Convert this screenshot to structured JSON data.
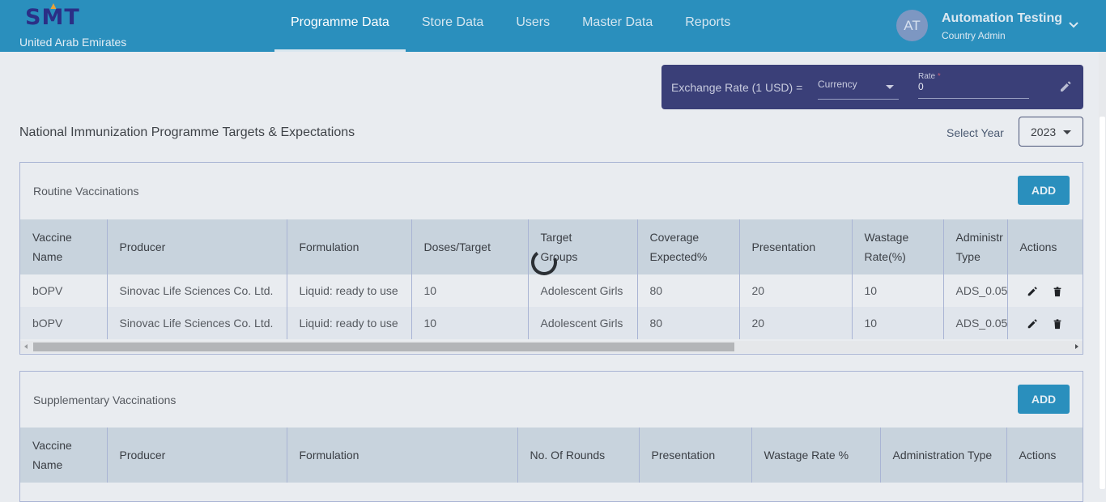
{
  "header": {
    "logo_text": "SMT",
    "country": "United Arab Emirates",
    "nav": [
      {
        "label": "Programme Data",
        "active": true
      },
      {
        "label": "Store Data",
        "active": false
      },
      {
        "label": "Users",
        "active": false
      },
      {
        "label": "Master Data",
        "active": false
      },
      {
        "label": "Reports",
        "active": false
      }
    ],
    "user": {
      "initials": "AT",
      "name": "Automation Testing",
      "role": "Country Admin"
    }
  },
  "exchange": {
    "label": "Exchange Rate (1 USD) =",
    "currency_label": "Currency",
    "rate_label": "Rate",
    "rate_required": "*",
    "rate_value": "0"
  },
  "page_title": "National Immunization Programme Targets & Expectations",
  "year": {
    "label": "Select Year",
    "value": "2023"
  },
  "routine": {
    "title": "Routine Vaccinations",
    "add_label": "ADD",
    "columns": [
      {
        "line1": "Vaccine",
        "line2": "Name"
      },
      {
        "line1": "Producer",
        "line2": ""
      },
      {
        "line1": "Formulation",
        "line2": ""
      },
      {
        "line1": "Doses/Target",
        "line2": ""
      },
      {
        "line1": "Target",
        "line2": "Groups"
      },
      {
        "line1": "Coverage",
        "line2": "Expected%"
      },
      {
        "line1": "Presentation",
        "line2": ""
      },
      {
        "line1": "Wastage",
        "line2": "Rate(%)"
      },
      {
        "line1": "Administr",
        "line2": "Type"
      },
      {
        "line1": "Actions",
        "line2": ""
      }
    ],
    "rows": [
      [
        "bOPV",
        "Sinovac Life Sciences Co. Ltd.",
        "Liquid: ready to use",
        "10",
        "Adolescent Girls",
        "80",
        "20",
        "10",
        "ADS_0.05"
      ],
      [
        "bOPV",
        "Sinovac Life Sciences Co. Ltd.",
        "Liquid: ready to use",
        "10",
        "Adolescent Girls",
        "80",
        "20",
        "10",
        "ADS_0.05"
      ]
    ]
  },
  "supplementary": {
    "title": "Supplementary Vaccinations",
    "add_label": "ADD",
    "columns": [
      {
        "line1": "Vaccine",
        "line2": "Name"
      },
      {
        "line1": "Producer",
        "line2": ""
      },
      {
        "line1": "Formulation",
        "line2": ""
      },
      {
        "line1": "No. Of Rounds",
        "line2": ""
      },
      {
        "line1": "Presentation",
        "line2": ""
      },
      {
        "line1": "Wastage Rate %",
        "line2": ""
      },
      {
        "line1": "Administration Type",
        "line2": ""
      },
      {
        "line1": "Actions",
        "line2": ""
      }
    ]
  },
  "colors": {
    "header_bg": "#2a8fbd",
    "exchange_bg": "#3a3f78",
    "table_header_bg": "#c8d3dd",
    "page_bg": "#e9ecf0"
  },
  "icons": [
    "chevron-down-icon",
    "pencil-icon",
    "trash-icon",
    "loading-spinner-icon"
  ]
}
